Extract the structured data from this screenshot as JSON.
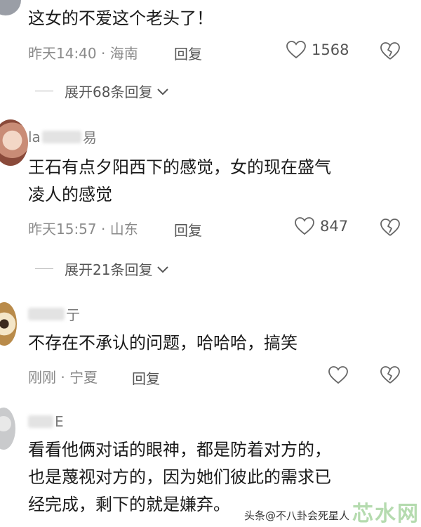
{
  "comments": [
    {
      "text": "这女的不爱这个老头了！",
      "meta": "昨天14:40 · 海南",
      "reply_label": "回复",
      "likes": "1568",
      "expand_label": "展开68条回复"
    },
    {
      "username_visible": "la",
      "username_tail": "易",
      "text_line1": "王石有点夕阳西下的感觉，女的现在盛气",
      "text_line2": "凌人的感觉",
      "meta": "昨天15:57 · 山东",
      "reply_label": "回复",
      "likes": "847",
      "expand_label": "展开21条回复"
    },
    {
      "username_tail": "亍",
      "text": "不存在不承认的问题，哈哈哈，搞笑",
      "meta": "刚刚 · 宁夏",
      "reply_label": "回复"
    },
    {
      "username_tail": "E",
      "text_line1": "看看他俩对话的眼神，都是防着对方的，",
      "text_line2": "也是蔑视对方的，因为她们彼此的需求已",
      "text_line3": "经完成，剩下的就是嫌弃。"
    }
  ],
  "watermark": {
    "small": "头条@不八卦会死星人",
    "big": "芯水网"
  },
  "icons": {
    "like": "heart-outline-icon",
    "dislike": "broken-heart-icon",
    "expand": "chevron-down-icon"
  },
  "colors": {
    "text": "#1a1a1a",
    "meta": "#8a8a8a",
    "watermark_big": "#78be6e"
  }
}
